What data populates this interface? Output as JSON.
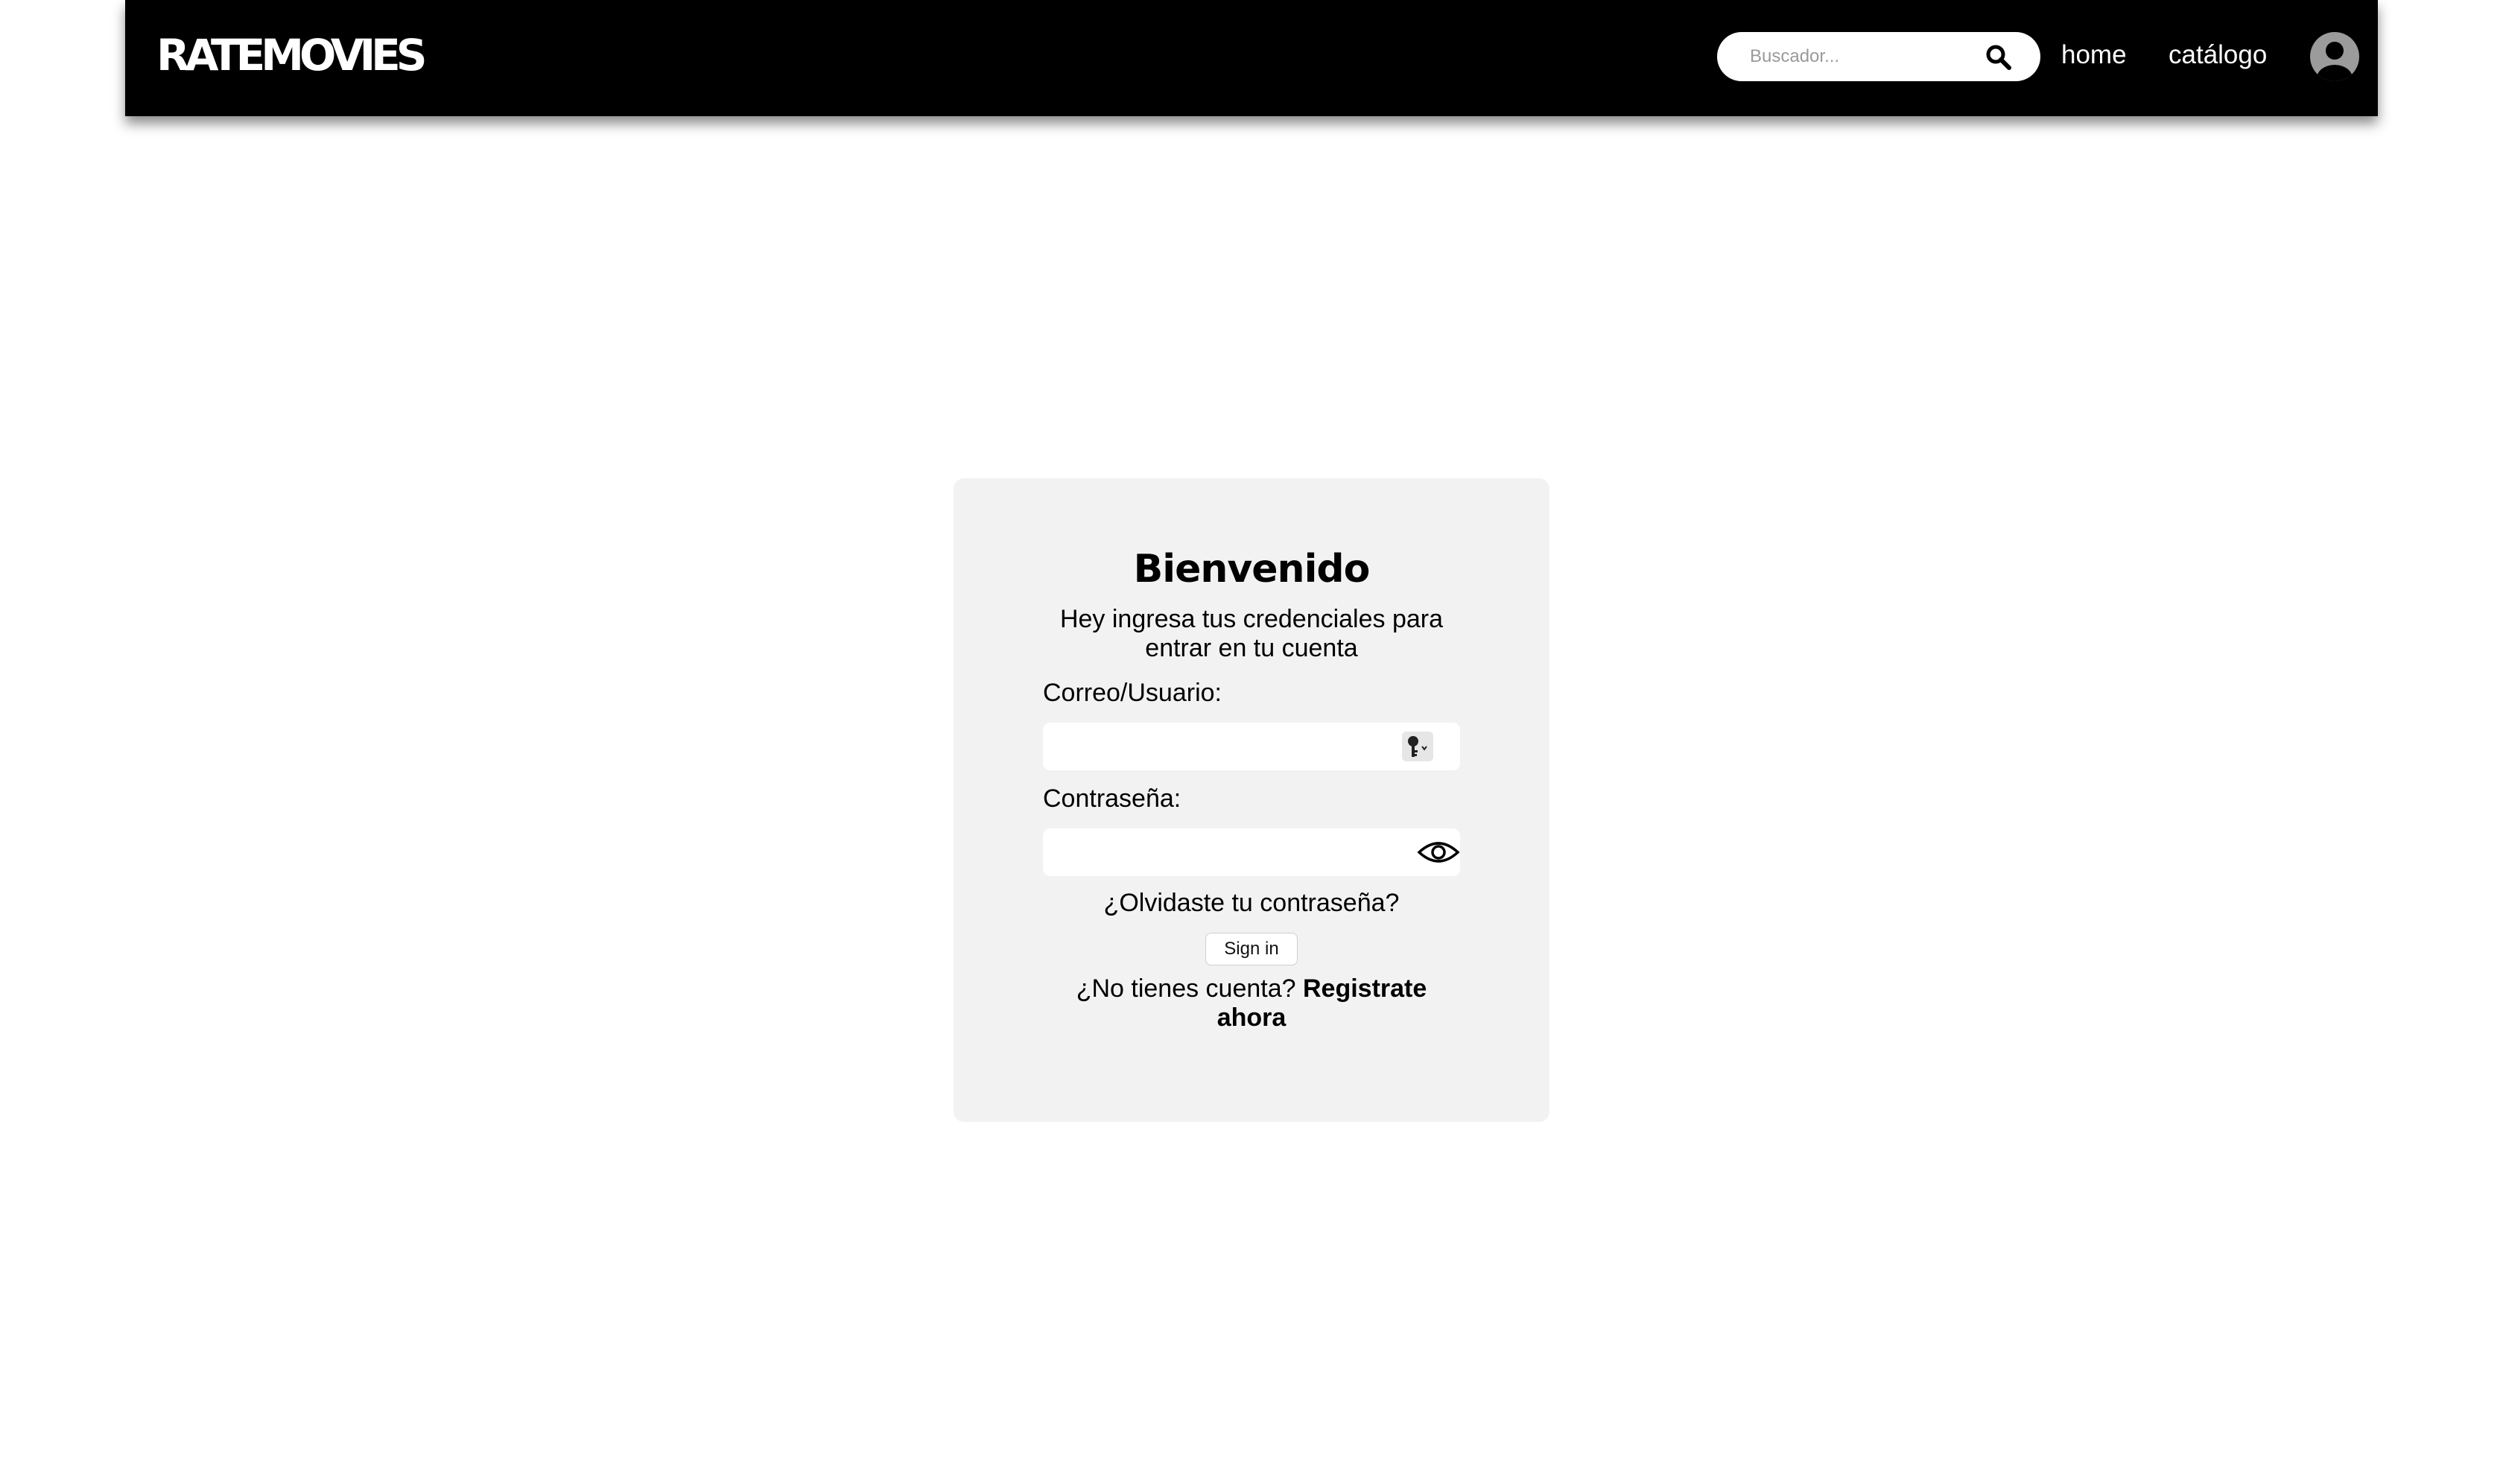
{
  "header": {
    "logo": "RATEMOVIES",
    "search": {
      "placeholder": "Buscador...",
      "icon": "search-icon"
    },
    "nav": {
      "home": "home",
      "catalog": "catálogo"
    },
    "profile_icon": "user-avatar-icon"
  },
  "login": {
    "title": "Bienvenido",
    "subtitle": "Hey ingresa tus credenciales para entrar en tu cuenta",
    "user_label": "Correo/Usuario:",
    "user_value": "",
    "user_field_icon": "key-icon",
    "password_label": "Contraseña:",
    "password_value": "",
    "password_toggle_icon": "eye-icon",
    "forgot_link": "¿Olvidaste tu contraseña?",
    "signin_button": "Sign in",
    "register_prompt": "¿No tienes cuenta?",
    "register_link": "Registrate ahora"
  },
  "colors": {
    "header_bg": "#000000",
    "card_bg": "#f2f2f2",
    "page_bg": "#ffffff"
  }
}
